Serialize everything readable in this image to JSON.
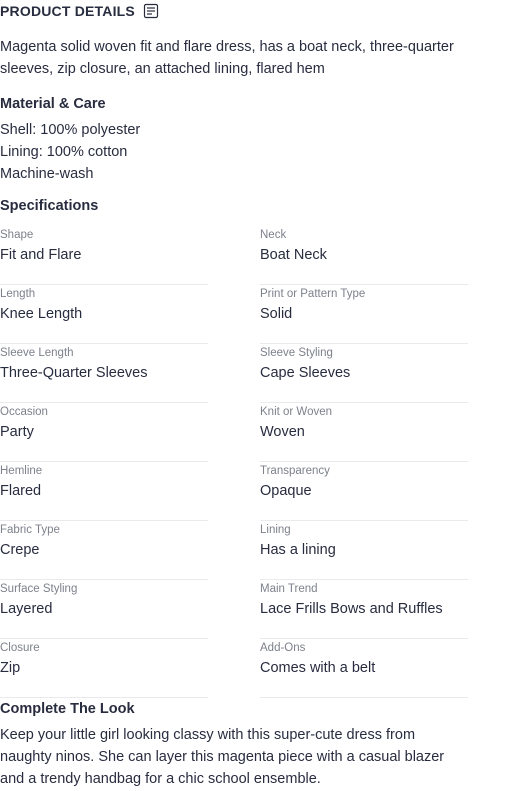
{
  "product_details": {
    "title": "PRODUCT DETAILS",
    "icon": "document-list-icon",
    "description": "Magenta solid woven fit and flare dress, has a boat neck, three-quarter sleeves, zip closure, an attached lining, flared hem"
  },
  "material_care": {
    "heading": "Material & Care",
    "lines": [
      "Shell: 100% polyester",
      "Lining: 100% cotton",
      "Machine-wash"
    ]
  },
  "specifications": {
    "heading": "Specifications",
    "items": [
      {
        "key": "Shape",
        "value": "Fit and Flare"
      },
      {
        "key": "Neck",
        "value": "Boat Neck"
      },
      {
        "key": "Length",
        "value": "Knee Length"
      },
      {
        "key": "Print or Pattern Type",
        "value": "Solid"
      },
      {
        "key": "Sleeve Length",
        "value": "Three-Quarter Sleeves"
      },
      {
        "key": "Sleeve Styling",
        "value": "Cape Sleeves"
      },
      {
        "key": "Occasion",
        "value": "Party"
      },
      {
        "key": "Knit or Woven",
        "value": "Woven"
      },
      {
        "key": "Hemline",
        "value": "Flared"
      },
      {
        "key": "Transparency",
        "value": "Opaque"
      },
      {
        "key": "Fabric Type",
        "value": "Crepe"
      },
      {
        "key": "Lining",
        "value": "Has a lining"
      },
      {
        "key": "Surface Styling",
        "value": "Layered"
      },
      {
        "key": "Main Trend",
        "value": "Lace Frills Bows and Ruffles"
      },
      {
        "key": "Closure",
        "value": "Zip"
      },
      {
        "key": "Add-Ons",
        "value": "Comes with a belt"
      }
    ]
  },
  "complete_the_look": {
    "heading": "Complete The Look",
    "text": "Keep your little girl looking classy with this super-cute dress from naughty ninos. She can layer this magenta piece with a casual blazer and a trendy handbag for a chic school ensemble."
  }
}
